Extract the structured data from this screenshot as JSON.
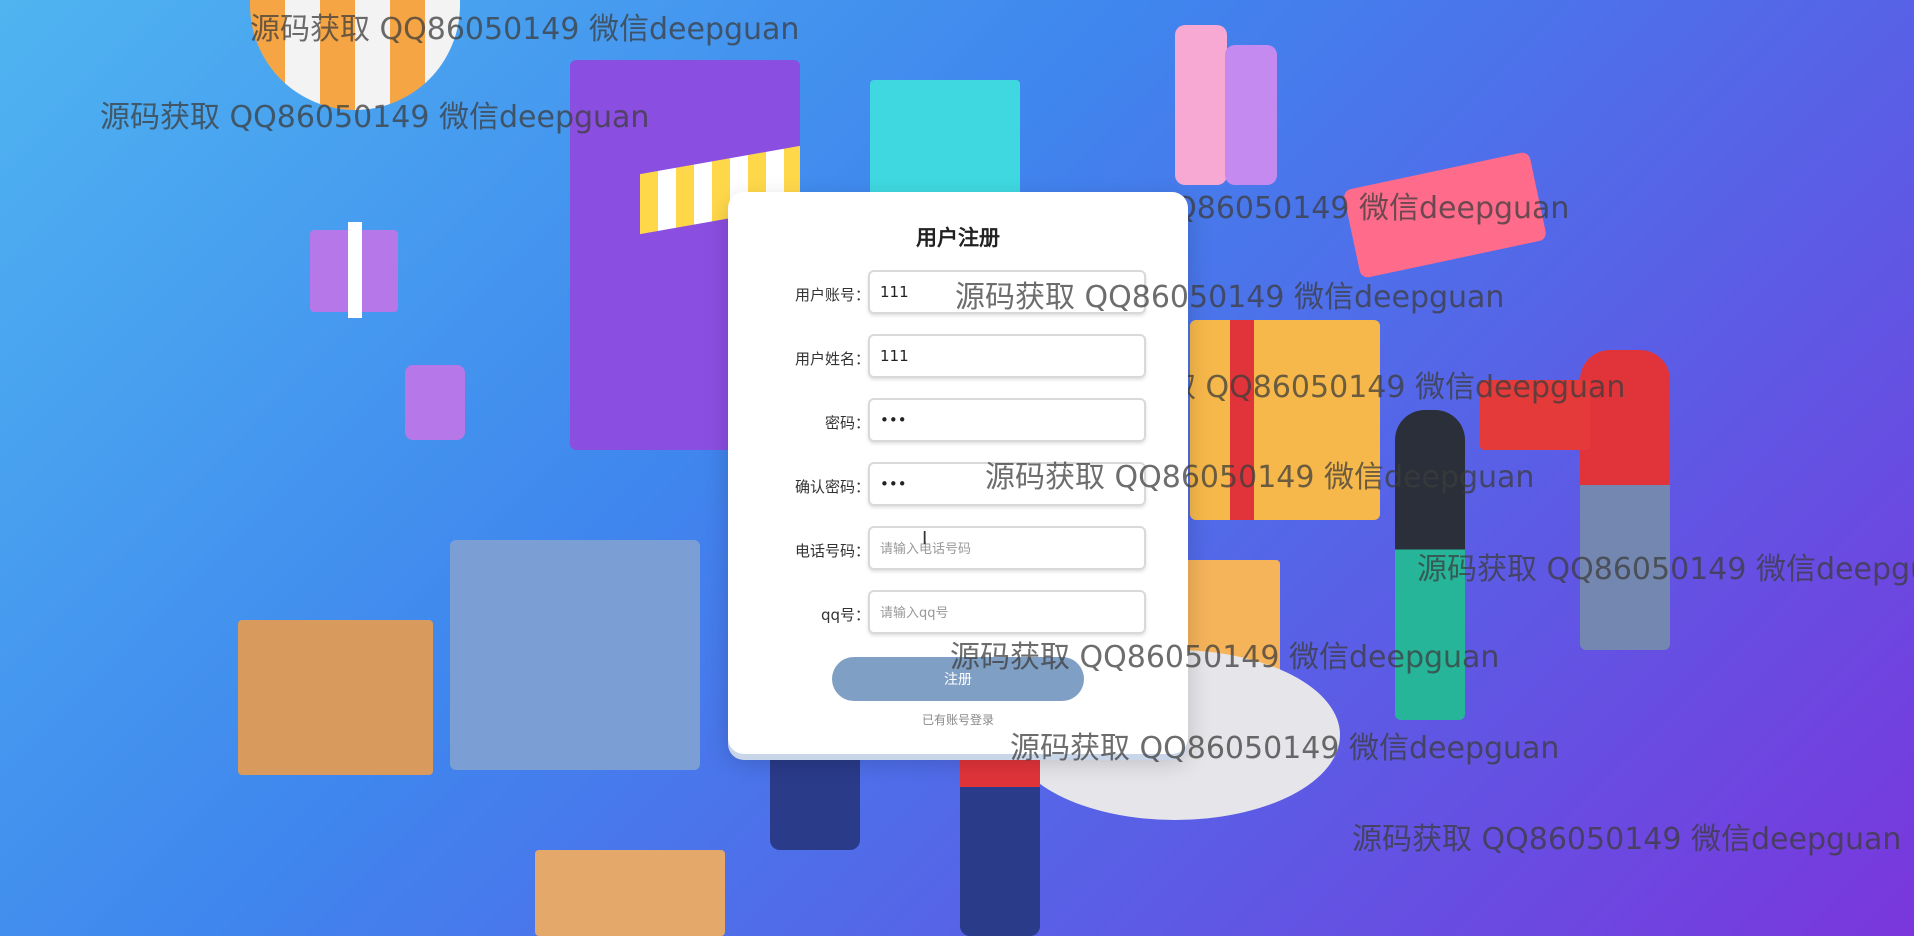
{
  "colors": {
    "background_start": "#4fb4f0",
    "background_end": "#7a36dc",
    "button": "#7f9fc4",
    "card": "#ffffff"
  },
  "form": {
    "title": "用户注册",
    "fields": [
      {
        "label": "用户账号：",
        "value": "111",
        "placeholder": "",
        "type": "text"
      },
      {
        "label": "用户姓名：",
        "value": "111",
        "placeholder": "",
        "type": "text"
      },
      {
        "label": "密码：",
        "value": "111",
        "placeholder": "",
        "type": "password"
      },
      {
        "label": "确认密码：",
        "value": "111",
        "placeholder": "",
        "type": "password"
      },
      {
        "label": "电话号码：",
        "value": "",
        "placeholder": "请输入电话号码",
        "type": "text"
      },
      {
        "label": "qq号：",
        "value": "",
        "placeholder": "请输入qq号",
        "type": "text"
      }
    ],
    "register_label": "注册",
    "login_link": "已有账号登录"
  },
  "watermark": {
    "text": "源码获取 QQ86050149 微信deepguan"
  }
}
